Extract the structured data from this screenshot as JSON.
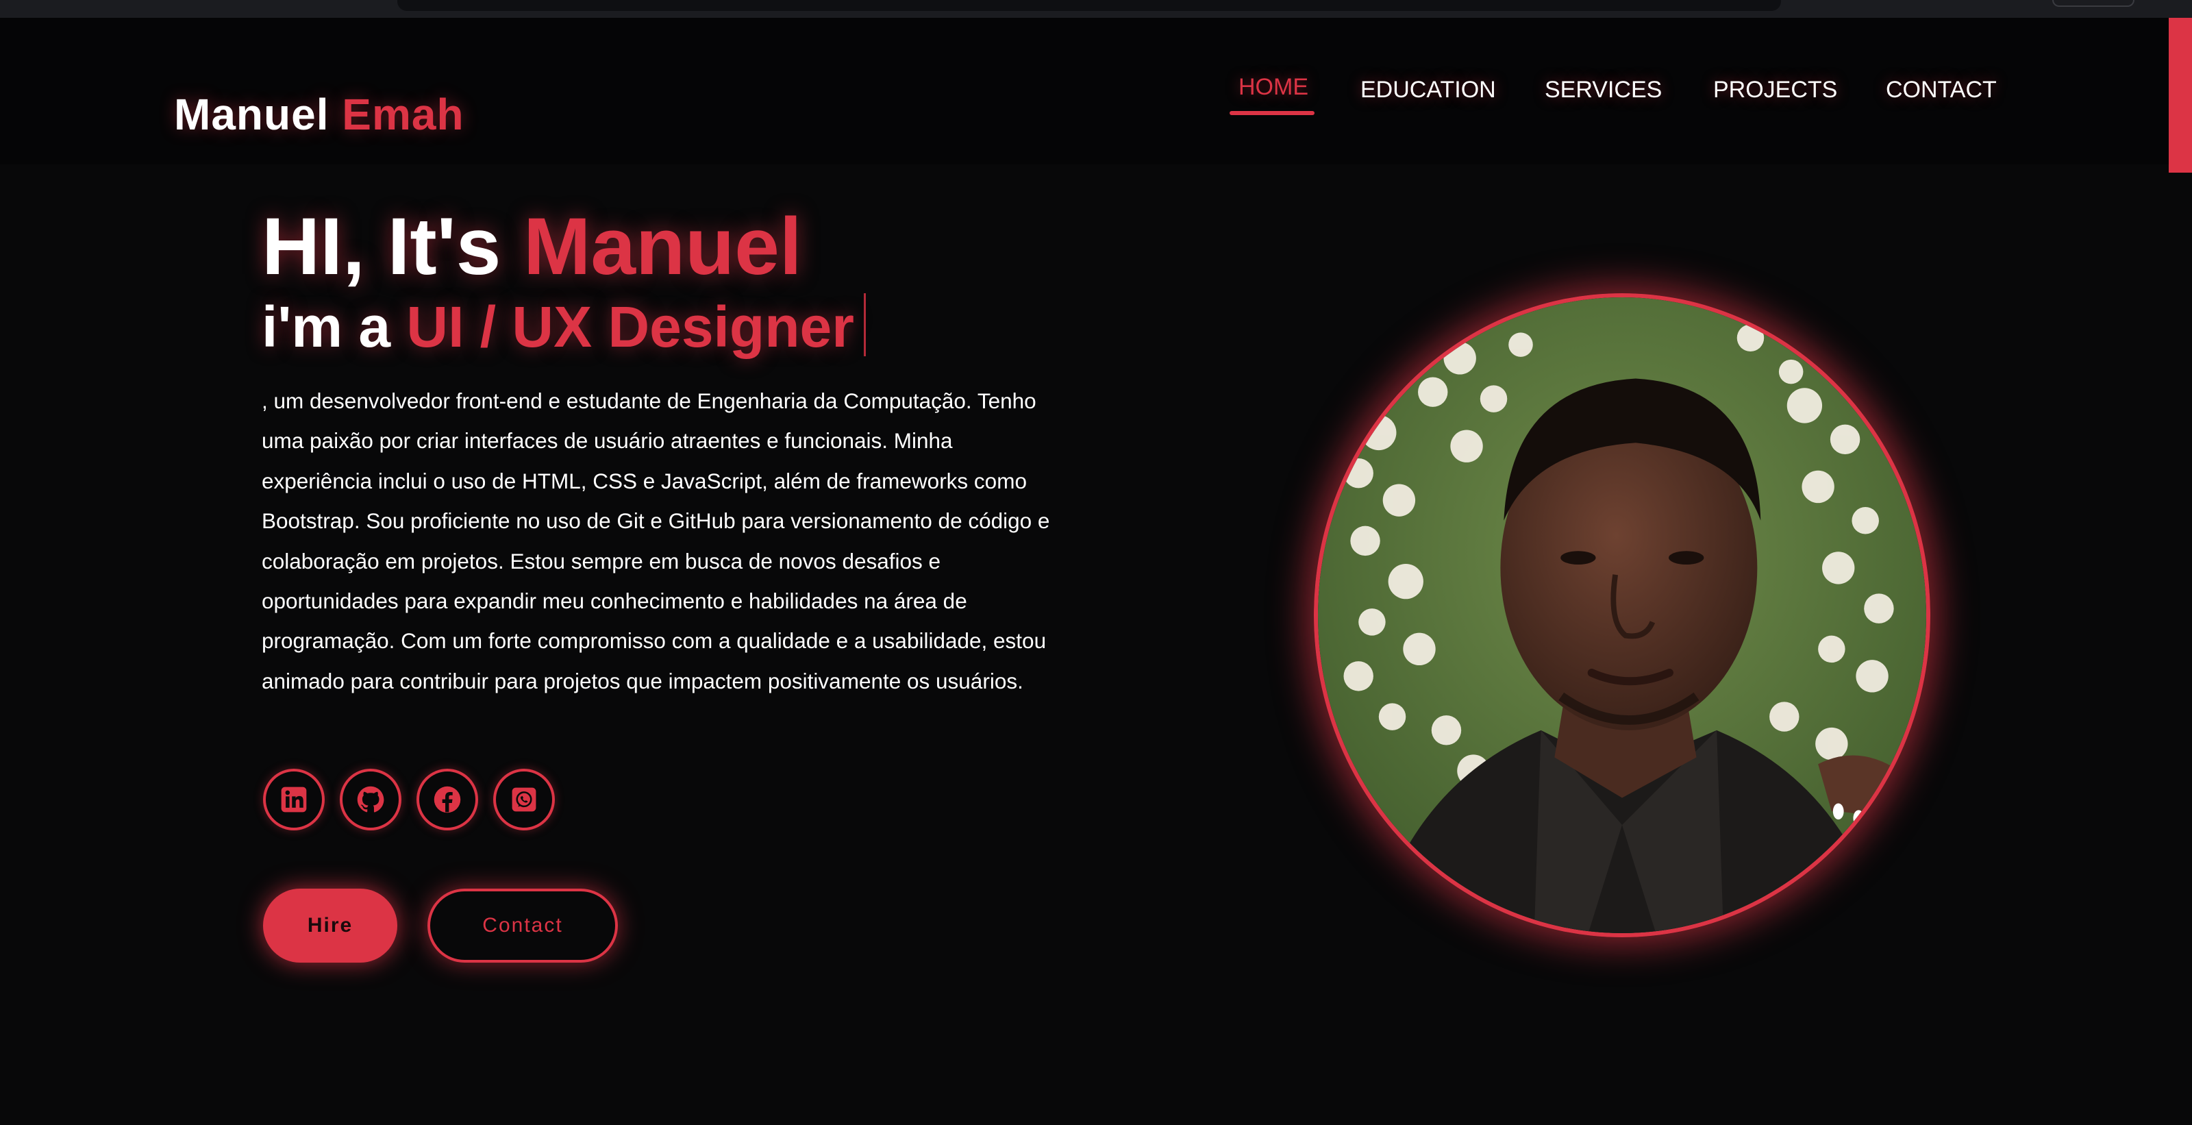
{
  "brand": {
    "first_name": "Manuel",
    "last_name": "Emah",
    "accent_color": "#dc3445"
  },
  "nav": {
    "items": [
      {
        "label": "HOME",
        "active": true
      },
      {
        "label": "EDUCATION",
        "active": false
      },
      {
        "label": "SERVICES",
        "active": false
      },
      {
        "label": "PROJECTS",
        "active": false
      },
      {
        "label": "CONTACT",
        "active": false
      }
    ]
  },
  "hero": {
    "greeting": "HI, It's",
    "name": "Manuel",
    "role_prefix": "i'm a",
    "role": "UI / UX Designer",
    "bio": ", um desenvolvedor front-end e estudante de Engenharia da Computação. Tenho uma paixão por criar interfaces de usuário atraentes e funcionais. Minha experiência inclui o uso de HTML, CSS e JavaScript, além de frameworks como Bootstrap. Sou proficiente no uso de Git e GitHub para versionamento de código e colaboração em projetos. Estou sempre em busca de novos desafios e oportunidades para expandir meu conhecimento e habilidades na área de programação. Com um forte compromisso com a qualidade e a usabilidade, estou animado para contribuir para projetos que impactem positivamente os usuários."
  },
  "socials": [
    {
      "icon": "linkedin-icon"
    },
    {
      "icon": "github-icon"
    },
    {
      "icon": "facebook-icon"
    },
    {
      "icon": "whatsapp-icon"
    }
  ],
  "buttons": {
    "hire": "Hire",
    "contact": "Contact"
  }
}
